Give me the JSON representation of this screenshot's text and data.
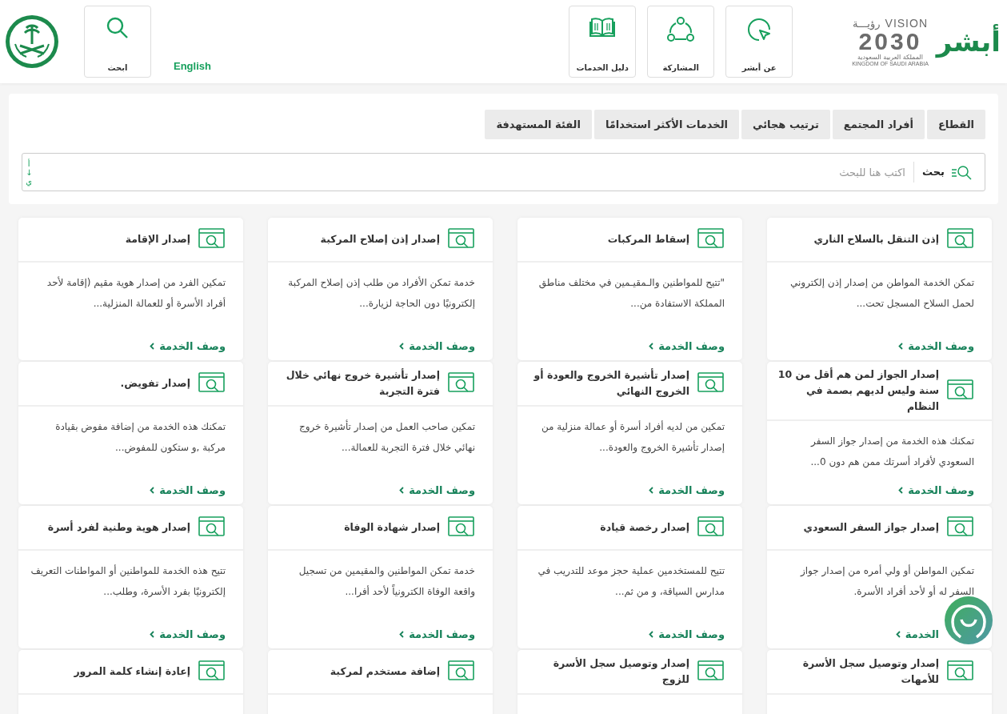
{
  "header": {
    "logo": {
      "brand": "أبشر",
      "vision_word": "VISION",
      "vision_arabic": "رؤيـــة",
      "vision_year": "2030",
      "country_arabic": "المملكة العربية السعودية",
      "country_english": "KINGDOM OF SAUDI ARABIA"
    },
    "nav": [
      {
        "kind": "pointer",
        "label": "عن أبشر"
      },
      {
        "kind": "share",
        "label": "المشاركة"
      },
      {
        "kind": "book",
        "label": "دليل الخدمات"
      }
    ],
    "language": "English",
    "search_button": "ابحث"
  },
  "filters": {
    "tabs": [
      {
        "label": "القطاع",
        "selected": false
      },
      {
        "label": "أفراد المجتمع",
        "selected": false
      },
      {
        "label": "ترتيب هجائي",
        "selected": false
      },
      {
        "label": "الخدمات الأكثر استخدامًا",
        "selected": false
      },
      {
        "label": "الفئة المستهدفة",
        "selected": false
      }
    ],
    "search": {
      "label": "بحث",
      "placeholder": "اكتب هنا للبحث",
      "sort": [
        "أ",
        "↓",
        "ي"
      ]
    }
  },
  "cards": [
    {
      "title": "إذن التنقل بالسلاح الناري",
      "description": "تمكن الخدمة المواطن من إصدار إذن إلكتروني لحمل السلاح المسجل تحت...",
      "link": "وصف الخدمة"
    },
    {
      "title": "إسقاط المركبات",
      "description": "\"تتيح للمواطنين والـمقيـمين في مختلف مناطق المملكة الاستفادة من...",
      "link": "وصف الخدمة"
    },
    {
      "title": "إصدار إذن إصلاح المركبة",
      "description": "خدمة تمكن الأفراد من طلب إذن إصلاح المركبة إلكترونيًا دون الحاجة لزيارة...",
      "link": "وصف الخدمة"
    },
    {
      "title": "إصدار الإقامة",
      "description": "تمكين الفرد من إصدار هوية مقيم (إقامة لأحد أفراد الأسرة أو للعمالة المنزلية...",
      "link": "وصف الخدمة"
    },
    {
      "title": "إصدار الجواز لمن هم أقل من 10 سنة وليس لديهم بصمة في النظام",
      "description": "تمكنك هذه الخدمة من إصدار جواز السفر السعودي لأفراد أسرتك ممن هم دون 0...",
      "link": "وصف الخدمة"
    },
    {
      "title": "إصدار تأشيرة الخروج والعودة أو الخروج النهائي",
      "description": "تمكين من لديه أفراد أسرة أو عمالة منزلية من إصدار تأشيرة الخروج والعودة...",
      "link": "وصف الخدمة"
    },
    {
      "title": "إصدار تأشيرة خروج نهائي خلال فترة التجربة",
      "description": "تمكين صاحب العمل من إصدار تأشيرة خروج نهائي خلال فترة التجربة للعمالة...",
      "link": "وصف الخدمة"
    },
    {
      "title": "إصدار تفويض.",
      "description": "تمكنك هذه الخدمة من إضافة مفوض بقيادة مركبة ,و ستكون للمفوض...",
      "link": "وصف الخدمة"
    },
    {
      "title": "إصدار جواز السفر السعودي",
      "description": "تمكين المواطن أو ولي أمره من إصدار جواز السفر له أو لأحد أفراد الأسرة.",
      "link": "الخدمة",
      "under_chat": true
    },
    {
      "title": "إصدار رخصة قيادة",
      "description": "تتيح للمستخدمين عملية حجز موعد للتدريب في مدارس السياقة، و من ثم...",
      "link": "وصف الخدمة"
    },
    {
      "title": "إصدار شهادة الوفاة",
      "description": "خدمة تمكن المواطنين والمقيمين من تسجيل واقعة الوفاة الكترونياً لأحد أفرا...",
      "link": "وصف الخدمة"
    },
    {
      "title": "إصدار هوية وطنية لفرد أسرة",
      "description": "تتيح هذه الخدمة للمواطنين أو المواطنات التعريف إلكترونيًا بفرد الأسرة، وطلب...",
      "link": "وصف الخدمة"
    },
    {
      "title": "إصدار وتوصيل سجل الأسرة للأمهات"
    },
    {
      "title": "إصدار وتوصيل سجل الأسرة للزوج"
    },
    {
      "title": "إضافة مستخدم لمركبة"
    },
    {
      "title": "إعادة إنشاء كلمة المرور"
    }
  ]
}
